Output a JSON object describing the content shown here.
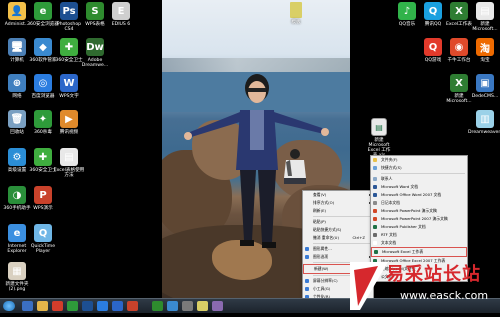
{
  "desktop_left_icons": [
    {
      "label": "Administ...",
      "color": "#f2c04a",
      "glyph": "👤"
    },
    {
      "label": "360安全浏览器",
      "color": "#2e9b3a",
      "glyph": "e"
    },
    {
      "label": "Photoshop CS4",
      "color": "#1d4f91",
      "glyph": "Ps"
    },
    {
      "label": "WPS表格",
      "color": "#2e8b2e",
      "glyph": "S"
    },
    {
      "label": "EDIUS 6",
      "color": "#cfcfcf",
      "glyph": "E"
    },
    {
      "label": "计算机",
      "color": "#4b7fb5",
      "glyph": "🖥"
    },
    {
      "label": "360软件管家",
      "color": "#3a8ad0",
      "glyph": "◆"
    },
    {
      "label": "360安全卫士",
      "color": "#3fae3f",
      "glyph": "✚"
    },
    {
      "label": "Adobe Dreamwe...",
      "color": "#2f6a2f",
      "glyph": "Dw"
    },
    {
      "label": "网络",
      "color": "#3f7fbf",
      "glyph": "⊕"
    },
    {
      "label": "百度浏览器",
      "color": "#2b7de0",
      "glyph": "◎"
    },
    {
      "label": "WPS文字",
      "color": "#2b66c9",
      "glyph": "W"
    },
    {
      "label": "回收站",
      "color": "#7aa0c2",
      "glyph": "🗑"
    },
    {
      "label": "360杀毒",
      "color": "#2e9b3a",
      "glyph": "✦"
    },
    {
      "label": "腾讯视频",
      "color": "#e08a2b",
      "glyph": "▶"
    },
    {
      "label": "高级设置",
      "color": "#2b8ed6",
      "glyph": "⚙"
    },
    {
      "label": "360安全卫士",
      "color": "#3fae3f",
      "glyph": "✚"
    },
    {
      "label": "Excel表格使用方法",
      "color": "#e8e8e8",
      "glyph": "▤"
    },
    {
      "label": "360手机助手",
      "color": "#2a8f3a",
      "glyph": "◑"
    },
    {
      "label": "WPS演示",
      "color": "#c9422b",
      "glyph": "P"
    },
    {
      "label": "Internet Explorer",
      "color": "#3b8fe0",
      "glyph": "e"
    },
    {
      "label": "QuickTime Player",
      "color": "#6fb6e6",
      "glyph": "Q"
    },
    {
      "label": "新建文件夹 (2).png",
      "color": "#d9d0c0",
      "glyph": "▦"
    }
  ],
  "desktop_right_icons": [
    {
      "label": "QQ音乐",
      "color": "#31b34a",
      "glyph": "♪"
    },
    {
      "label": "腾讯QQ",
      "color": "#1aa0e0",
      "glyph": "Q"
    },
    {
      "label": "Excel工作表",
      "color": "#2e7d32",
      "glyph": "X"
    },
    {
      "label": "新建 Microsoft...",
      "color": "#e8e8e8",
      "glyph": "▤"
    },
    {
      "label": "QQ游戏",
      "color": "#e23a2b",
      "glyph": "Q"
    },
    {
      "label": "千牛工作台",
      "color": "#e04a2b",
      "glyph": "◉"
    },
    {
      "label": "淘宝",
      "color": "#ee6a00",
      "glyph": "淘"
    },
    {
      "label": "新建 Microsoft...",
      "color": "#2e7d32",
      "glyph": "X"
    },
    {
      "label": "DedeCMS...",
      "color": "#3a78c2",
      "glyph": "▣"
    },
    {
      "label": "Dreamweaver...",
      "color": "#9bd1e8",
      "glyph": "▥"
    }
  ],
  "desktop_file": {
    "label": "新建 Microsoft Excel 工作表.xls"
  },
  "photo_file": {
    "label": "模板"
  },
  "context_menu": {
    "items": [
      {
        "label": "查看(V)",
        "arrow": true
      },
      {
        "label": "排序方式(O)",
        "arrow": true
      },
      {
        "label": "刷新(E)"
      },
      {
        "sep": true
      },
      {
        "label": "粘贴(P)"
      },
      {
        "label": "粘贴快捷方式(S)"
      },
      {
        "label": "撤消 重命名(U)",
        "shortcut": "Ctrl+Z"
      },
      {
        "sep": true
      },
      {
        "label": "图形属性...",
        "icon": "#3a7bd5"
      },
      {
        "label": "图形选项",
        "icon": "#3a7bd5",
        "arrow": true
      },
      {
        "sep": true
      },
      {
        "label": "新建(W)",
        "arrow": true,
        "highlight": true
      },
      {
        "sep": true
      },
      {
        "label": "屏幕分辨率(C)",
        "icon": "#3a7bd5"
      },
      {
        "label": "小工具(G)",
        "icon": "#3a7bd5"
      },
      {
        "label": "个性化(R)",
        "icon": "#3a7bd5"
      }
    ]
  },
  "submenu": {
    "items": [
      {
        "label": "文件夹(F)",
        "icon": "#e8c04a"
      },
      {
        "label": "快捷方式(S)",
        "icon": "#6aa0d8"
      },
      {
        "sep": true
      },
      {
        "label": "联系人",
        "icon": "#8aa8c8"
      },
      {
        "label": "Microsoft Word 文档",
        "icon": "#2b5797"
      },
      {
        "label": "Microsoft Office Word 2007 文档",
        "icon": "#2b5797"
      },
      {
        "label": "日记本文档",
        "icon": "#8a8a8a"
      },
      {
        "label": "Microsoft PowerPoint 演示文稿",
        "icon": "#d24726"
      },
      {
        "label": "Microsoft PowerPoint 2007 演示文稿",
        "icon": "#d24726"
      },
      {
        "label": "Microsoft Publisher 文档",
        "icon": "#1e7145"
      },
      {
        "label": "RTF 文档",
        "icon": "#6a6a6a"
      },
      {
        "label": "文本文档",
        "icon": "#ffffff"
      },
      {
        "label": "Microsoft Excel 工作表",
        "icon": "#1e7145",
        "highlight": true
      },
      {
        "label": "Microsoft Office Excel 2007 工作表",
        "icon": "#1e7145"
      },
      {
        "label": "压缩(zipped)文件夹",
        "icon": "#e8c04a"
      },
      {
        "label": "公文包",
        "icon": "#b8863a"
      }
    ]
  },
  "taskbar": {
    "time": "",
    "tray_label": "CH"
  },
  "watermark": {
    "text": "易采站长站",
    "url": "www.easck.com"
  },
  "colors": {
    "menu_bg": "#f0f0f0",
    "highlight_border": "#d9534f",
    "watermark_red": "#d6282d"
  }
}
